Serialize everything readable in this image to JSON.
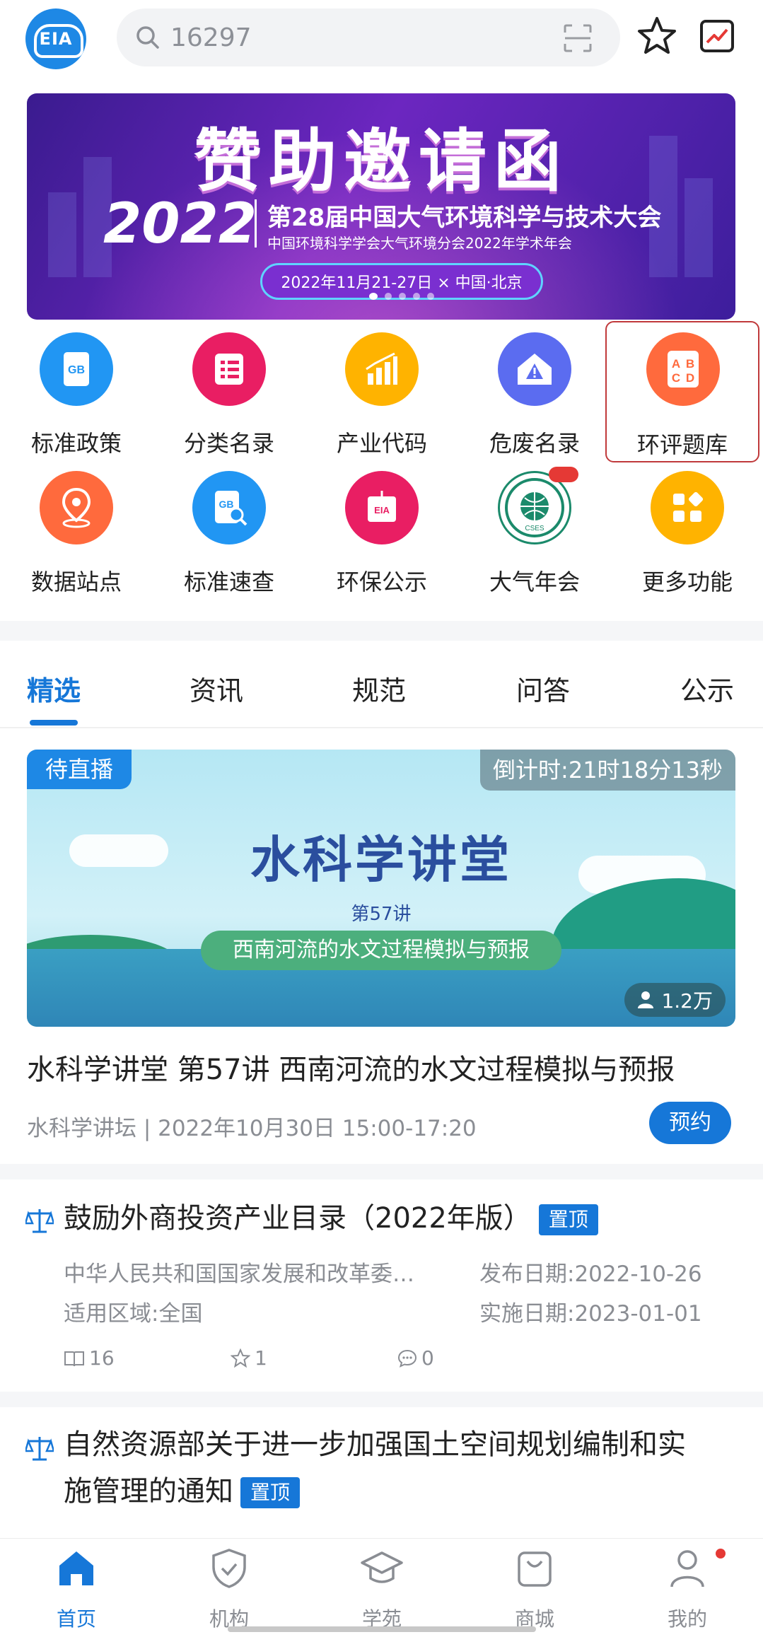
{
  "header": {
    "logo_text": "EIA",
    "search_value": "16297",
    "icons": [
      "search-icon",
      "scan-icon",
      "star-icon",
      "trend-icon"
    ]
  },
  "banner": {
    "title": "赞助邀请函",
    "year": "2022",
    "conference": "第28届中国大气环境科学与技术大会",
    "subtitle": "中国环境科学学会大气环境分会2022年学术年会",
    "date_location": "2022年11月21-27日 × 中国·北京"
  },
  "grid": [
    {
      "label": "标准政策",
      "icon": "gb-doc-icon",
      "color": "#2196f3"
    },
    {
      "label": "分类名录",
      "icon": "list-icon",
      "color": "#e91e63"
    },
    {
      "label": "产业代码",
      "icon": "bar-chart-icon",
      "color": "#ffb300"
    },
    {
      "label": "危废名录",
      "icon": "warning-house-icon",
      "color": "#5b6cf0"
    },
    {
      "label": "环评题库",
      "icon": "abcd-icon",
      "color": "#ff6a3d"
    },
    {
      "label": "数据站点",
      "icon": "location-icon",
      "color": "#ff6a3d"
    },
    {
      "label": "标准速查",
      "icon": "gb-search-icon",
      "color": "#2196f3"
    },
    {
      "label": "环保公示",
      "icon": "eia-board-icon",
      "color": "#e91e63"
    },
    {
      "label": "大气年会",
      "icon": "cses-seal-icon",
      "color": "#1b8a6b"
    },
    {
      "label": "更多功能",
      "icon": "more-apps-icon",
      "color": "#ffb300"
    }
  ],
  "tabs": [
    "精选",
    "资讯",
    "规范",
    "问答",
    "公示"
  ],
  "live_card": {
    "status_badge": "待直播",
    "countdown": "倒计时:21时18分13秒",
    "image_title": "水科学讲堂",
    "image_episode": "第57讲",
    "image_subtitle": "西南河流的水文过程模拟与预报",
    "views": "1.2万",
    "title": "水科学讲堂 第57讲 西南河流的水文过程模拟与预报",
    "meta": "水科学讲坛  |  2022年10月30日 15:00-17:20",
    "reserve_button": "预约"
  },
  "docs": [
    {
      "title": "鼓励外商投资产业目录（2022年版）",
      "tag": "置顶",
      "issuer": "中华人民共和国国家发展和改革委…",
      "publish_date": "发布日期:2022-10-26",
      "region": "适用区域:全国",
      "effective_date": "实施日期:2023-01-01",
      "reads": "16",
      "stars": "1",
      "comments": "0"
    },
    {
      "title_line1": "自然资源部关于进一步加强国土空间规划编制和实",
      "title_line2": "施管理的通知",
      "tag": "置顶"
    }
  ],
  "bottom_nav": [
    "首页",
    "机构",
    "学苑",
    "商城",
    "我的"
  ],
  "colors": {
    "accent": "#1677d8",
    "highlight_border": "#c0393b"
  }
}
